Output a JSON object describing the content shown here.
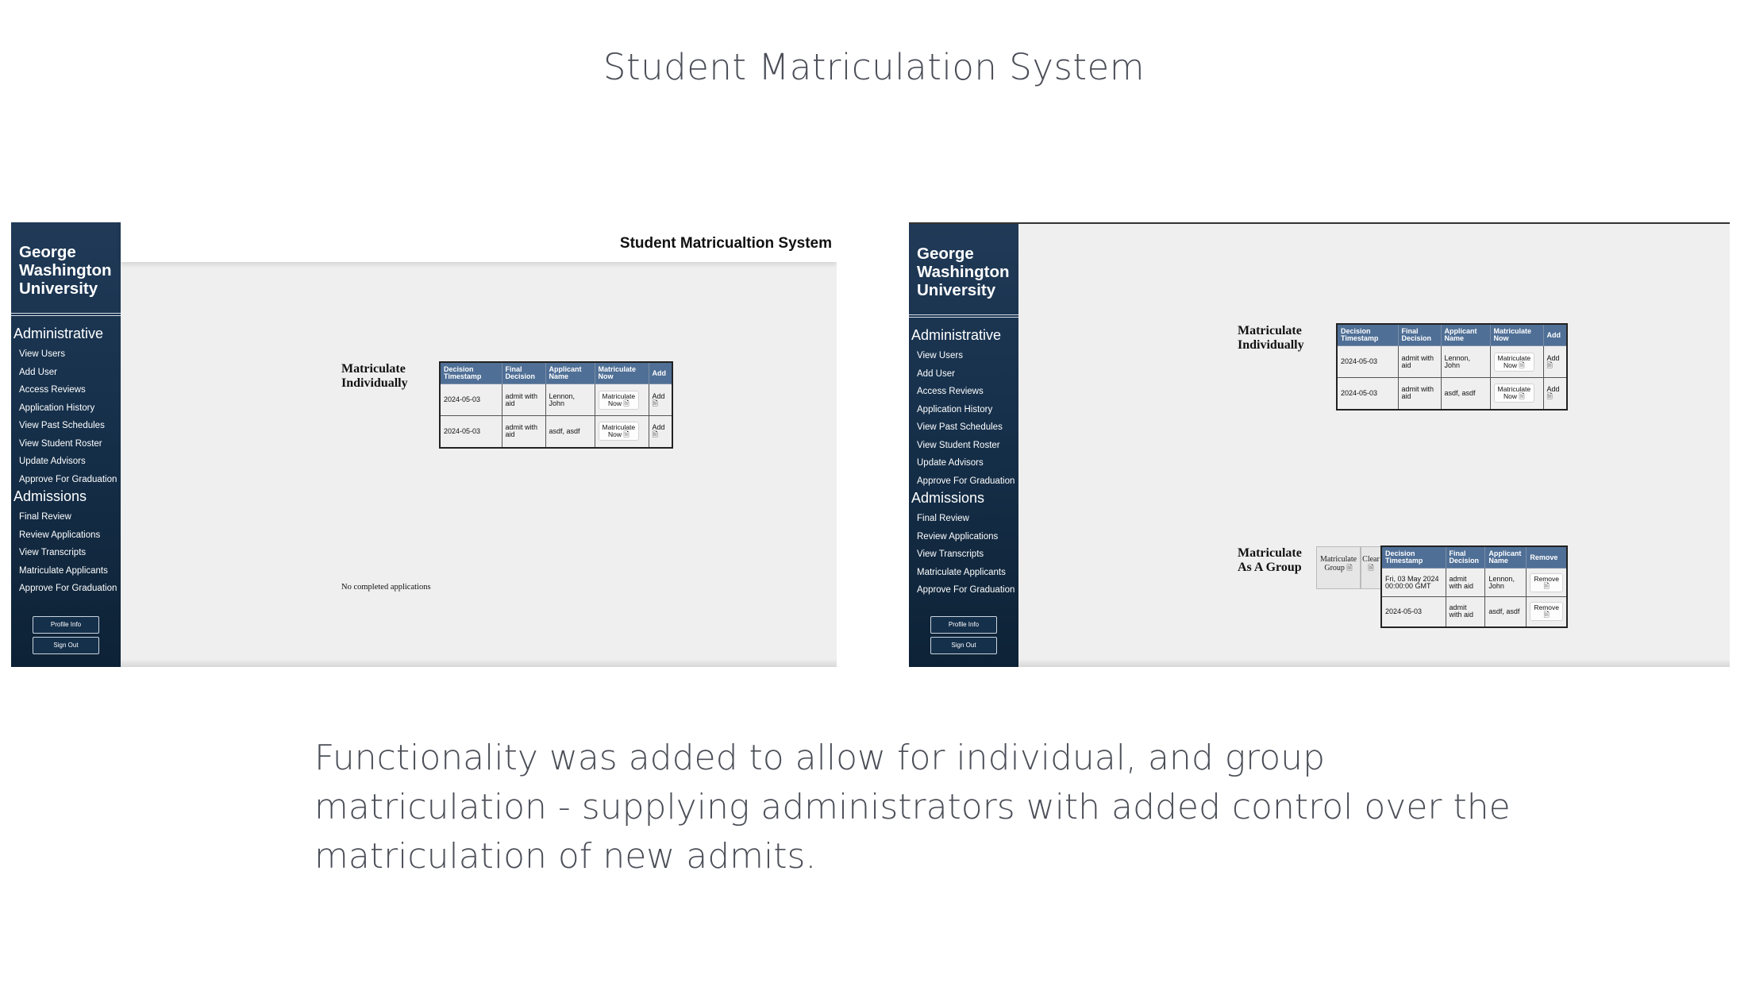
{
  "slide": {
    "title": "Student Matriculation System",
    "caption_lines": [
      "Functionality was added to allow for individual, and group",
      "matriculation - supplying administrators with added control over the",
      "matriculation of new admits."
    ]
  },
  "app": {
    "logo_lines": [
      "George",
      "Washington",
      "University"
    ],
    "topbar_title": "Student Matricualtion System",
    "sections": [
      {
        "label": "Administrative",
        "items": [
          "View Users",
          "Add User",
          "Access Reviews",
          "Application History",
          "View Past Schedules",
          "View Student Roster",
          "Update Advisors",
          "Approve For Graduation"
        ]
      },
      {
        "label": "Admissions",
        "items": [
          "Final Review",
          "Review Applications",
          "View Transcripts",
          "Matriculate Applicants",
          "Approve For Graduation"
        ]
      }
    ],
    "profile_button": "Profile Info",
    "signout_button": "Sign Out"
  },
  "individual": {
    "heading_lines": [
      "Matriculate",
      "Individually"
    ],
    "headers": [
      [
        "Decision",
        "Timestamp"
      ],
      [
        "Final",
        "Decision"
      ],
      [
        "Applicant",
        "Name"
      ],
      [
        "Matriculate",
        "Now"
      ],
      [
        "Add"
      ]
    ],
    "rows": [
      {
        "timestamp": "2024-05-03",
        "decision": [
          "admit with",
          "aid"
        ],
        "name": [
          "Lennon,",
          "John"
        ],
        "action": [
          "Matriculate",
          "Now"
        ],
        "add": "Add"
      },
      {
        "timestamp": "2024-05-03",
        "decision": [
          "admit with",
          "aid"
        ],
        "name": [
          "asdf, asdf"
        ],
        "action": [
          "Matriculate",
          "Now"
        ],
        "add": "Add"
      }
    ]
  },
  "left_note": "No completed applications",
  "group": {
    "heading_lines": [
      "Matriculate",
      "As A Group"
    ],
    "matriculate_group": [
      "Matriculate",
      "Group"
    ],
    "clear": "Clear",
    "headers": [
      [
        "Decision",
        "Timestamp"
      ],
      [
        "Final",
        "Decision"
      ],
      [
        "Applicant",
        "Name"
      ],
      [
        "Remove"
      ]
    ],
    "rows": [
      {
        "timestamp": [
          "Fri, 03 May 2024",
          "00:00:00 GMT"
        ],
        "decision": [
          "admit",
          "with aid"
        ],
        "name": [
          "Lennon,",
          "John"
        ],
        "remove": "Remove"
      },
      {
        "timestamp": [
          "2024-05-03"
        ],
        "decision": [
          "admit",
          "with aid"
        ],
        "name": [
          "asdf, asdf"
        ],
        "remove": "Remove"
      }
    ]
  },
  "icons": {
    "document": "document-icon"
  },
  "colors": {
    "sidebar": "#17314c",
    "table_header": "#4f6f96",
    "content_bg": "#efefef"
  }
}
